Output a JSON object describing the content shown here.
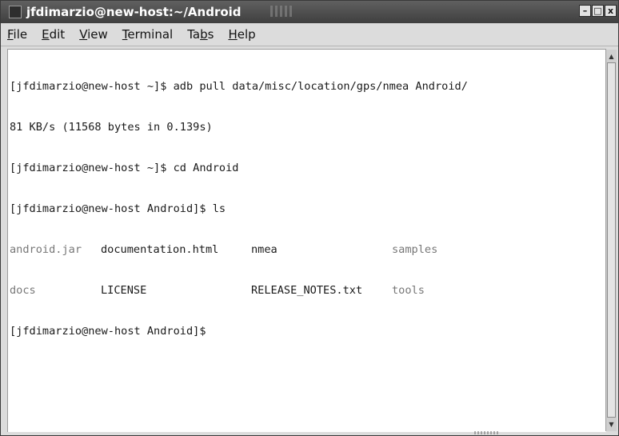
{
  "window": {
    "title": "jfdimarzio@new-host:~/Android",
    "buttons": {
      "minimize": "–",
      "maximize": "□",
      "close": "x"
    }
  },
  "menu": {
    "items": [
      {
        "mnemonic": "F",
        "rest": "ile"
      },
      {
        "mnemonic": "E",
        "rest": "dit"
      },
      {
        "mnemonic": "V",
        "rest": "iew"
      },
      {
        "mnemonic": "T",
        "rest": "erminal"
      },
      {
        "pre": "Ta",
        "mnemonic": "b",
        "rest": "s"
      },
      {
        "mnemonic": "H",
        "rest": "elp"
      }
    ]
  },
  "terminal": {
    "lines": [
      "[jfdimarzio@new-host ~]$ adb pull data/misc/location/gps/nmea Android/",
      "81 KB/s (11568 bytes in 0.139s)",
      "[jfdimarzio@new-host ~]$ cd Android",
      "[jfdimarzio@new-host Android]$ ls"
    ],
    "ls_rows": [
      [
        "android.jar",
        "documentation.html",
        "nmea",
        "samples"
      ],
      [
        "docs",
        "LICENSE",
        "RELEASE_NOTES.txt",
        "tools"
      ]
    ],
    "prompt": "[jfdimarzio@new-host Android]$"
  }
}
